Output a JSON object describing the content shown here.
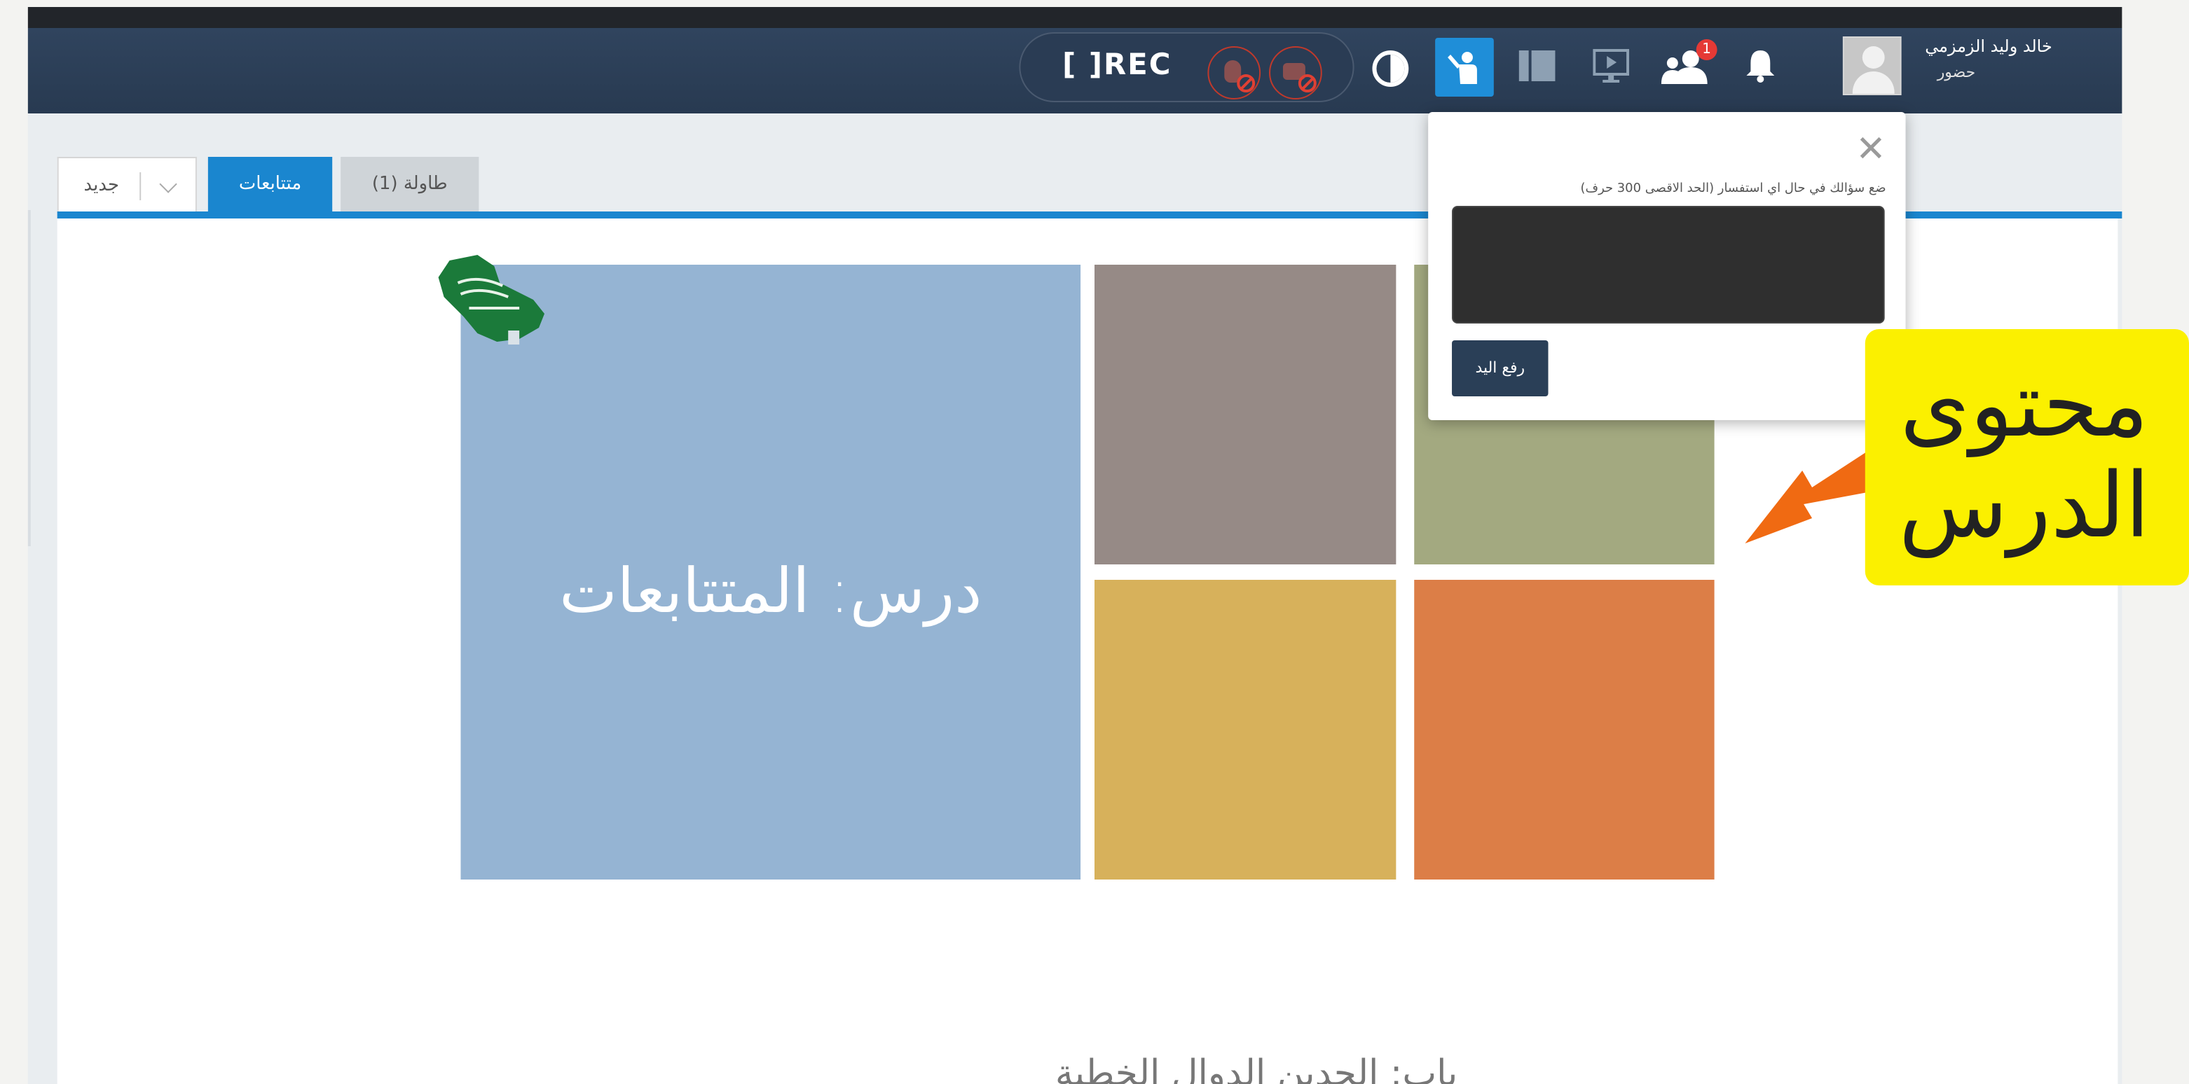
{
  "toolbar": {
    "rec_label": "[ ]REC",
    "mic_icon": "mic-off-icon",
    "camera_icon": "camera-off-icon",
    "contrast_icon": "contrast-icon",
    "raise_hand_icon": "raise-hand-icon",
    "layout_icon": "layout-icon",
    "screen_icon": "screen-share-icon",
    "participants_icon": "participants-icon",
    "participants_badge": "1",
    "notifications_icon": "bell-icon",
    "accent_color": "#1f8ed8",
    "bar_color": "#2b3e55"
  },
  "user": {
    "name": "خالد وليد الزمزمي",
    "role": "حضور"
  },
  "tabs": {
    "new_label": "جديد",
    "active_label": "متتابعات",
    "table_label": "طاولة (1)"
  },
  "slide": {
    "title": "درس: المتتابعات",
    "flag_icon": "saudi-map-flag-icon",
    "bottom_text": "باب: الحدين الدوال الخطية"
  },
  "popup": {
    "hint": "ضع سؤالك في حال اي استفسار   (الحد الاقصى 300 حرف)",
    "textarea_value": "",
    "submit_label": "رفع اليد",
    "close_symbol": "✕"
  },
  "callout": {
    "line1": "محتوى",
    "line2": "الدرس",
    "color": "#fbf000",
    "arrow_color": "#f06a12"
  }
}
